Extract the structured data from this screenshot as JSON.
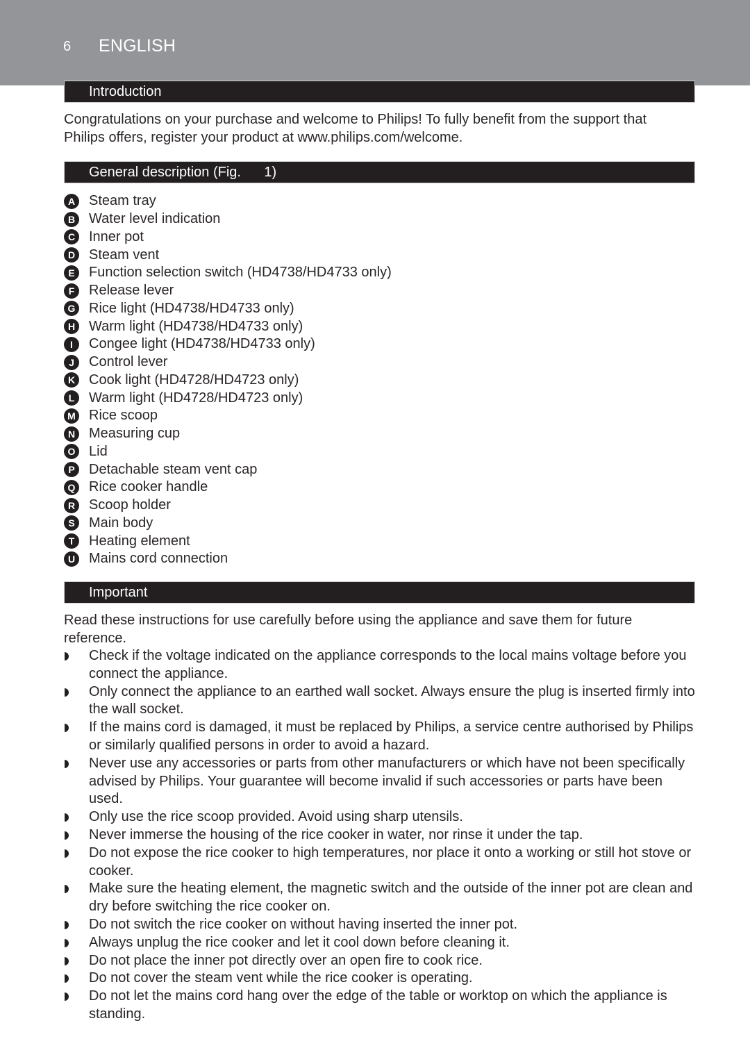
{
  "header": {
    "page_number": "6",
    "language": "ENGLISH"
  },
  "sections": {
    "introduction": {
      "title": "Introduction",
      "body_lines": [
        "Congratulations on your purchase and welcome to Philips! To fully benefit from the support that",
        "Philips offers, register your product at www.philips.com/welcome."
      ]
    },
    "general_description": {
      "title": "General description (Fig.      1)",
      "parts": [
        {
          "letter": "A",
          "label": "Steam tray"
        },
        {
          "letter": "B",
          "label": "Water level indication"
        },
        {
          "letter": "C",
          "label": "Inner pot"
        },
        {
          "letter": "D",
          "label": "Steam vent"
        },
        {
          "letter": "E",
          "label": "Function selection switch (HD4738/HD4733 only)"
        },
        {
          "letter": "F",
          "label": "Release lever"
        },
        {
          "letter": "G",
          "label": "Rice light (HD4738/HD4733 only)"
        },
        {
          "letter": "H",
          "label": "Warm light (HD4738/HD4733 only)"
        },
        {
          "letter": "I",
          "label": "Congee light (HD4738/HD4733 only)"
        },
        {
          "letter": "J",
          "label": "Control lever"
        },
        {
          "letter": "K",
          "label": "Cook light (HD4728/HD4723 only)"
        },
        {
          "letter": "L",
          "label": "Warm light (HD4728/HD4723 only)"
        },
        {
          "letter": "M",
          "label": "Rice scoop"
        },
        {
          "letter": "N",
          "label": "Measuring cup"
        },
        {
          "letter": "O",
          "label": "Lid"
        },
        {
          "letter": "P",
          "label": "Detachable steam vent cap"
        },
        {
          "letter": "Q",
          "label": "Rice cooker handle"
        },
        {
          "letter": "R",
          "label": "Scoop holder"
        },
        {
          "letter": "S",
          "label": "Main body"
        },
        {
          "letter": "T",
          "label": "Heating element"
        },
        {
          "letter": "U",
          "label": "Mains cord connection"
        }
      ]
    },
    "important": {
      "title": "Important",
      "intro_lines": [
        "Read these instructions for use carefully before using the appliance and save them for future",
        "reference."
      ],
      "warnings": [
        "Check if the voltage indicated on the appliance corresponds to the local mains voltage before you connect the appliance.",
        "Only connect the appliance to an earthed wall socket. Always ensure the plug is inserted firmly into the wall socket.",
        "If the mains cord is damaged, it must be replaced by Philips, a service centre authorised by Philips or similarly qualified persons in order to avoid a hazard.",
        "Never use any accessories or parts from other manufacturers or which have not been specifically advised by Philips. Your guarantee will become invalid if such accessories or parts have been used.",
        "Only use the rice scoop provided. Avoid using sharp utensils.",
        "Never immerse the housing of the rice cooker in water, nor rinse it under the tap.",
        "Do not expose the rice cooker to high temperatures, nor place it onto a working or still hot stove or cooker.",
        "Make sure the heating element, the magnetic switch and the outside of the inner pot are clean and dry before switching the rice cooker on.",
        "Do not switch the rice cooker on without having inserted the inner pot.",
        "Always unplug the rice cooker and let it cool down before cleaning it.",
        "Do not place the inner pot directly over an open fire to cook rice.",
        "Do not cover the steam vent while the rice cooker is operating.",
        "Do not let the mains cord hang over the edge of the table or worktop on which the appliance is standing."
      ]
    }
  }
}
